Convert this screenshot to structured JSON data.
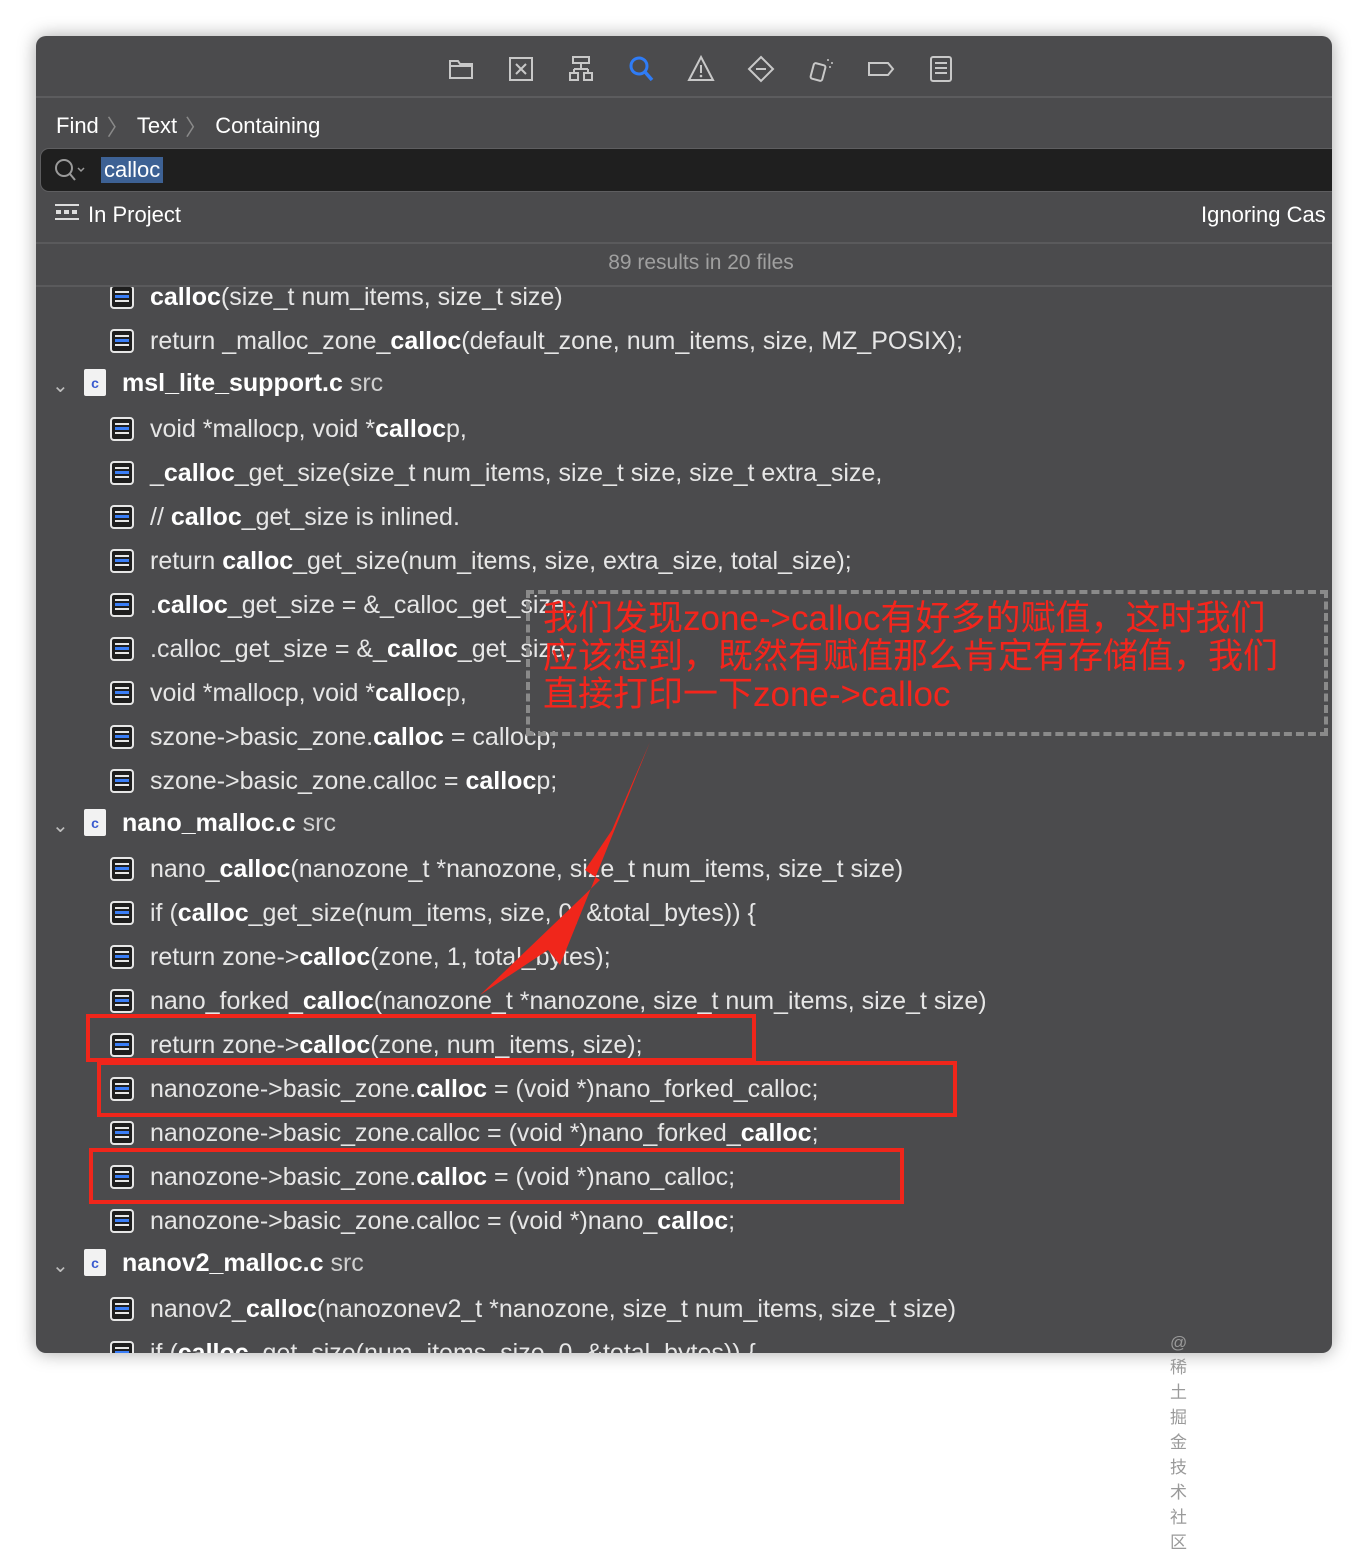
{
  "toolbar": {
    "icons": [
      "folder-icon",
      "source-control-icon",
      "hierarchy-icon",
      "search-icon",
      "warning-icon",
      "breakpoint-icon",
      "debug-icon",
      "tag-icon",
      "report-icon"
    ],
    "active": "search-icon",
    "accent": "#2f7cf6"
  },
  "breadcrumb": [
    "Find",
    "Text",
    "Containing"
  ],
  "search": {
    "value": "calloc"
  },
  "scope": {
    "label": "In Project",
    "case": "Ignoring Cas"
  },
  "summary": "89 results in 20 files",
  "rows": [
    {
      "type": "line",
      "parts": [
        {
          "t": "calloc",
          "b": true
        },
        {
          "t": "(size_t num_items, size_t size)"
        }
      ]
    },
    {
      "type": "line",
      "parts": [
        {
          "t": "return _malloc_zone_"
        },
        {
          "t": "calloc",
          "b": true
        },
        {
          "t": "(default_zone, num_items, size, MZ_POSIX);"
        }
      ]
    },
    {
      "type": "file",
      "name": "msl_lite_support.c",
      "dir": "src",
      "badge": "c"
    },
    {
      "type": "line",
      "parts": [
        {
          "t": "void *mallocp, void *"
        },
        {
          "t": "calloc",
          "b": true
        },
        {
          "t": "p,"
        }
      ]
    },
    {
      "type": "line",
      "parts": [
        {
          "t": "_"
        },
        {
          "t": "calloc",
          "b": true
        },
        {
          "t": "_get_size(size_t num_items, size_t size, size_t extra_size,"
        }
      ]
    },
    {
      "type": "line",
      "parts": [
        {
          "t": "// "
        },
        {
          "t": "calloc",
          "b": true
        },
        {
          "t": "_get_size is inlined."
        }
      ]
    },
    {
      "type": "line",
      "parts": [
        {
          "t": "return "
        },
        {
          "t": "calloc",
          "b": true
        },
        {
          "t": "_get_size(num_items, size, extra_size, total_size);"
        }
      ]
    },
    {
      "type": "line",
      "parts": [
        {
          "t": "."
        },
        {
          "t": "calloc",
          "b": true
        },
        {
          "t": "_get_size = &_calloc_get_size,"
        }
      ]
    },
    {
      "type": "line",
      "parts": [
        {
          "t": ".calloc_get_size = &_"
        },
        {
          "t": "calloc",
          "b": true
        },
        {
          "t": "_get_size,"
        }
      ]
    },
    {
      "type": "line",
      "parts": [
        {
          "t": "void *mallocp, void *"
        },
        {
          "t": "calloc",
          "b": true
        },
        {
          "t": "p,"
        }
      ]
    },
    {
      "type": "line",
      "parts": [
        {
          "t": "szone->basic_zone."
        },
        {
          "t": "calloc",
          "b": true
        },
        {
          "t": " = callocp;"
        }
      ]
    },
    {
      "type": "line",
      "parts": [
        {
          "t": "szone->basic_zone.calloc = "
        },
        {
          "t": "calloc",
          "b": true
        },
        {
          "t": "p;"
        }
      ]
    },
    {
      "type": "file",
      "name": "nano_malloc.c",
      "dir": "src",
      "badge": "c"
    },
    {
      "type": "line",
      "parts": [
        {
          "t": "nano_"
        },
        {
          "t": "calloc",
          "b": true
        },
        {
          "t": "(nanozone_t *nanozone, size_t num_items, size_t size)"
        }
      ]
    },
    {
      "type": "line",
      "parts": [
        {
          "t": "if ("
        },
        {
          "t": "calloc",
          "b": true
        },
        {
          "t": "_get_size(num_items, size, 0, &total_bytes)) {"
        }
      ]
    },
    {
      "type": "line",
      "parts": [
        {
          "t": "return zone->"
        },
        {
          "t": "calloc",
          "b": true
        },
        {
          "t": "(zone, 1, total_bytes);"
        }
      ]
    },
    {
      "type": "line",
      "parts": [
        {
          "t": "nano_forked_"
        },
        {
          "t": "calloc",
          "b": true
        },
        {
          "t": "(nanozone_t *nanozone, size_t num_items, size_t size)"
        }
      ]
    },
    {
      "type": "line",
      "parts": [
        {
          "t": "return zone->"
        },
        {
          "t": "calloc",
          "b": true
        },
        {
          "t": "(zone, num_items, size);"
        }
      ]
    },
    {
      "type": "line",
      "parts": [
        {
          "t": "nanozone->basic_zone."
        },
        {
          "t": "calloc",
          "b": true
        },
        {
          "t": " = (void *)nano_forked_calloc;"
        }
      ]
    },
    {
      "type": "line",
      "parts": [
        {
          "t": "nanozone->basic_zone.calloc = (void *)nano_forked_"
        },
        {
          "t": "calloc",
          "b": true
        },
        {
          "t": ";"
        }
      ]
    },
    {
      "type": "line",
      "parts": [
        {
          "t": "nanozone->basic_zone."
        },
        {
          "t": "calloc",
          "b": true
        },
        {
          "t": " = (void *)nano_calloc;"
        }
      ]
    },
    {
      "type": "line",
      "parts": [
        {
          "t": "nanozone->basic_zone.calloc = (void *)nano_"
        },
        {
          "t": "calloc",
          "b": true
        },
        {
          "t": ";"
        }
      ]
    },
    {
      "type": "file",
      "name": "nanov2_malloc.c",
      "dir": "src",
      "badge": "c"
    },
    {
      "type": "line",
      "parts": [
        {
          "t": "nanov2_"
        },
        {
          "t": "calloc",
          "b": true
        },
        {
          "t": "(nanozonev2_t *nanozone, size_t num_items, size_t size)"
        }
      ]
    },
    {
      "type": "line",
      "parts": [
        {
          "t": "if ("
        },
        {
          "t": "calloc",
          "b": true
        },
        {
          "t": "_get_size(num_items, size, 0, &total_bytes)) {"
        }
      ]
    }
  ],
  "annotation": {
    "lines": [
      "我们发现zone->calloc有好多的赋值，这时我们",
      "应该想到，既然有赋值那么肯定有存储值，我们",
      "直接打印一下zone->calloc"
    ],
    "color": "#f4251c"
  },
  "watermark": "@稀土掘金技术社区"
}
